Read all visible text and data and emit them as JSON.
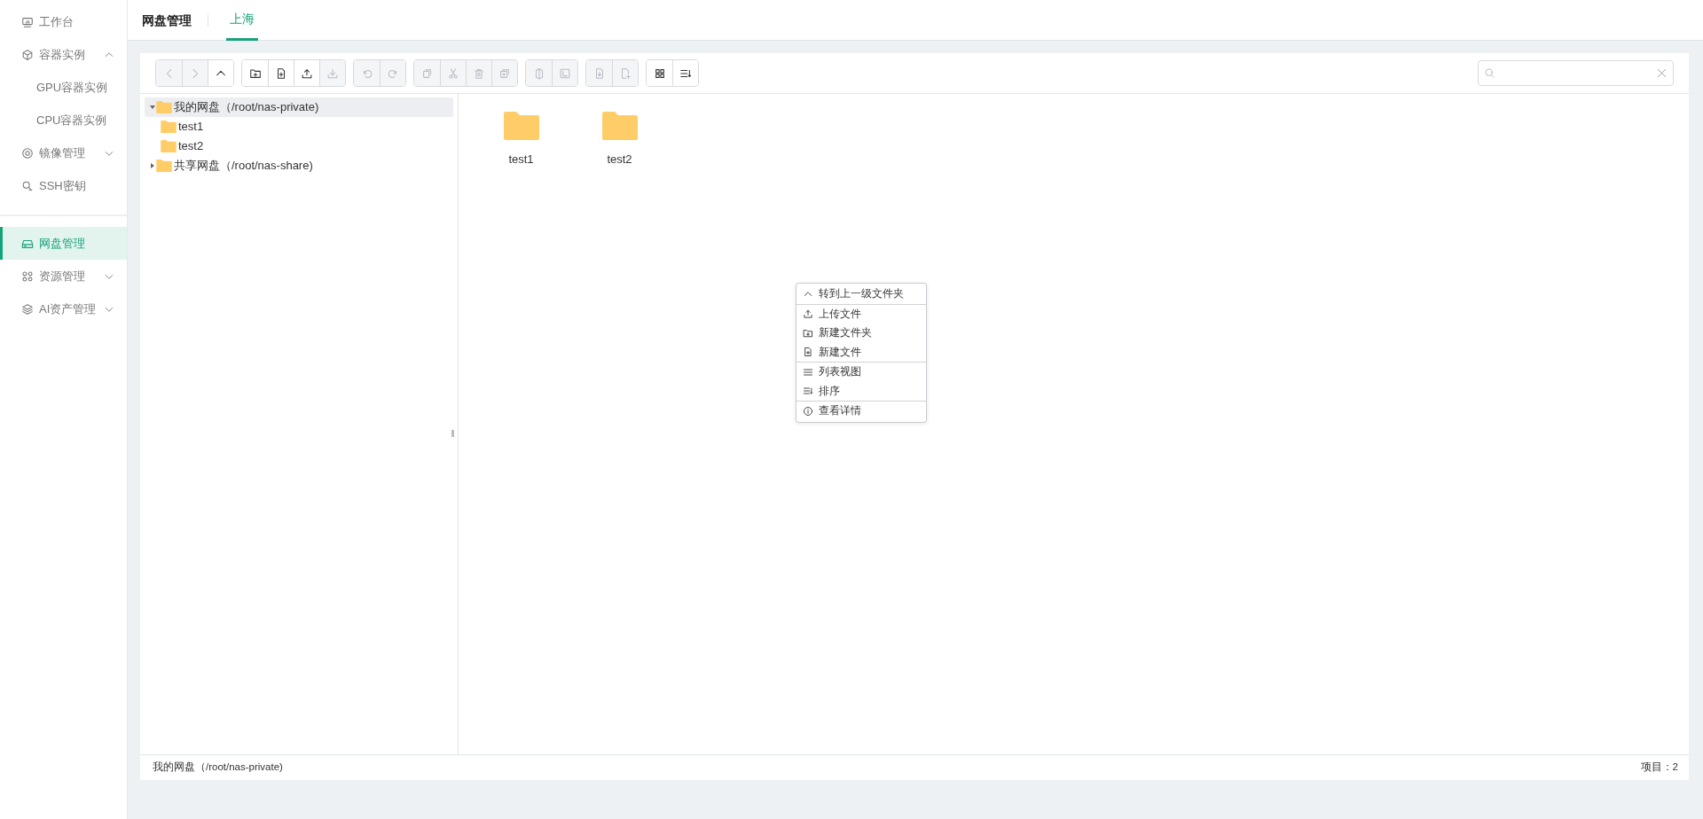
{
  "sidebar": {
    "groups": [
      [
        {
          "label": "工作台",
          "selected": false
        },
        {
          "label": "容器实例",
          "selected": false,
          "expanded": true,
          "children": [
            {
              "label": "GPU容器实例",
              "selected": false
            },
            {
              "label": "CPU容器实例",
              "selected": false
            }
          ]
        },
        {
          "label": "镜像管理",
          "selected": false,
          "expanded": false
        },
        {
          "label": "SSH密钥",
          "selected": false
        }
      ],
      [
        {
          "label": "网盘管理",
          "selected": true
        },
        {
          "label": "资源管理",
          "selected": false,
          "expanded": false
        },
        {
          "label": "AI资产管理",
          "selected": false,
          "expanded": false
        }
      ]
    ]
  },
  "header": {
    "title": "网盘管理",
    "tabs": [
      {
        "label": "上海",
        "selected": true
      }
    ]
  },
  "toolbar": {
    "groups": [
      [
        {
          "disabled": true
        },
        {
          "disabled": true
        },
        {
          "disabled": false
        }
      ],
      [
        {
          "disabled": false
        },
        {
          "disabled": false
        },
        {
          "disabled": false
        },
        {
          "disabled": true
        }
      ],
      [
        {
          "disabled": true
        },
        {
          "disabled": true
        }
      ],
      [
        {
          "disabled": true
        },
        {
          "disabled": true
        },
        {
          "disabled": true
        },
        {
          "disabled": true
        }
      ],
      [
        {
          "disabled": true
        },
        {
          "disabled": true
        }
      ],
      [
        {
          "disabled": true
        },
        {
          "disabled": true
        }
      ],
      [
        {
          "disabled": false
        },
        {
          "disabled": false
        }
      ]
    ]
  },
  "tree": [
    {
      "label": "我的网盘（/root/nas-private)",
      "selected": true,
      "expanded": true,
      "children": [
        {
          "label": "test1",
          "selected": false
        },
        {
          "label": "test2",
          "selected": false
        }
      ]
    },
    {
      "label": "共享网盘（/root/nas-share)",
      "selected": false,
      "expanded": false
    }
  ],
  "files": [
    {
      "name": "test1"
    },
    {
      "name": "test2"
    }
  ],
  "context_menu": {
    "groups": [
      [
        {
          "label": "转到上一级文件夹"
        }
      ],
      [
        {
          "label": "上传文件"
        },
        {
          "label": "新建文件夹"
        },
        {
          "label": "新建文件"
        }
      ],
      [
        {
          "label": "列表视图"
        },
        {
          "label": "排序"
        }
      ],
      [
        {
          "label": "查看详情"
        }
      ]
    ]
  },
  "status_bar": {
    "path": "我的网盘（/root/nas-private)",
    "count": "项目：2"
  }
}
